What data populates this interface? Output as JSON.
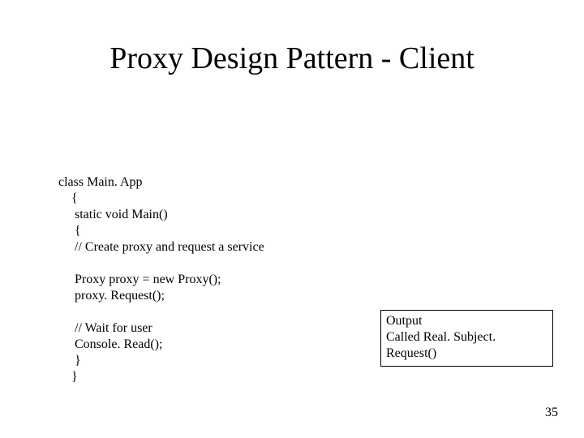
{
  "title": "Proxy Design Pattern - Client",
  "code": {
    "l01": "class Main. App",
    "l02": "    {",
    "l03": "     static void Main()",
    "l04": "     {",
    "l05": "     // Create proxy and request a service",
    "l06": "",
    "l07": "     Proxy proxy = new Proxy();",
    "l08": "     proxy. Request();",
    "l09": "",
    "l10": "     // Wait for user",
    "l11": "     Console. Read();",
    "l12": "     }",
    "l13": "    }"
  },
  "output": {
    "line1": "Output",
    "line2": "Called Real. Subject. Request()"
  },
  "page_number": "35"
}
